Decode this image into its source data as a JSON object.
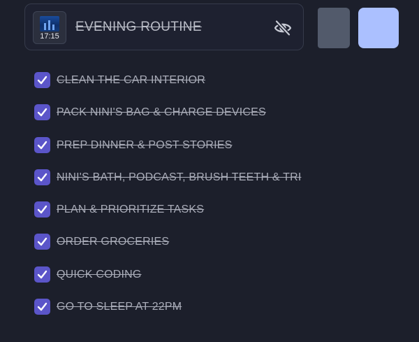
{
  "routine": {
    "title": "EVENING ROUTINE",
    "time": "17:15",
    "completed": true
  },
  "icons": {
    "visibility_toggle": "eye-off-icon",
    "task_check": "checkmark-icon",
    "thumbnail": "city-night-image"
  },
  "colors": {
    "background": "#1c1f2b",
    "checkbox": "#5b55c9",
    "secondary_button": "#525a6b",
    "primary_button": "#abc0ff"
  },
  "tasks": [
    {
      "label": "CLEAN THE CAR INTERIOR",
      "done": true
    },
    {
      "label": "PACK NINI'S BAG & CHARGE DEVICES",
      "done": true
    },
    {
      "label": "PREP DINNER & POST STORIES",
      "done": true
    },
    {
      "label": "NINI'S BATH, PODCAST, BRUSH TEETH & TRI",
      "done": true
    },
    {
      "label": "PLAN & PRIORITIZE TASKS",
      "done": true
    },
    {
      "label": "ORDER GROCERIES",
      "done": true
    },
    {
      "label": "QUICK CODING",
      "done": true
    },
    {
      "label": "GO TO SLEEP AT 22PM",
      "done": true
    }
  ]
}
